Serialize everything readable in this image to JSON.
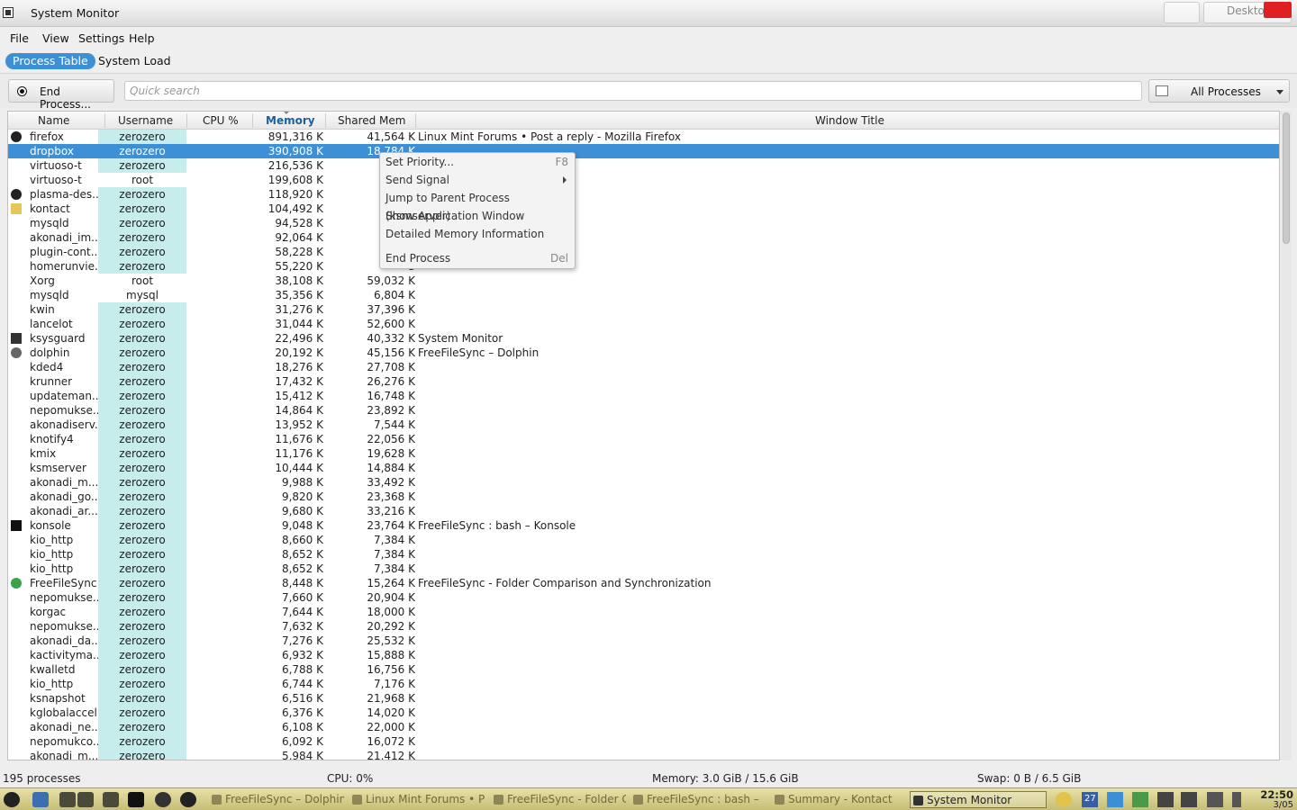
{
  "window": {
    "title": "System Monitor",
    "behind_title": "Desktop"
  },
  "menu": [
    "File",
    "View",
    "Settings",
    "Help"
  ],
  "tabs": [
    "Process Table",
    "System Load"
  ],
  "toolbar": {
    "end_process": "End Process...",
    "search_placeholder": "Quick search",
    "filter": "All Processes"
  },
  "columns": [
    "Name",
    "Username",
    "CPU %",
    "Memory",
    "Shared Mem",
    "Window Title"
  ],
  "rows": [
    {
      "icon": "firefox-icon",
      "name": "firefox",
      "user": "zerozero",
      "cpu": "",
      "mem": "891,316 K",
      "shared": "41,564 K",
      "title": "Linux Mint Forums • Post a reply - Mozilla Firefox"
    },
    {
      "icon": "",
      "name": "dropbox",
      "user": "zerozero",
      "cpu": "",
      "mem": "390,908 K",
      "shared": "18,784 K",
      "title": "",
      "selected": true
    },
    {
      "icon": "",
      "name": "virtuoso-t",
      "user": "zerozero",
      "cpu": "",
      "mem": "216,536 K",
      "shared": "1",
      "title": ""
    },
    {
      "icon": "",
      "name": "virtuoso-t",
      "user": "root",
      "cpu": "",
      "mem": "199,608 K",
      "shared": "1",
      "title": ""
    },
    {
      "icon": "plasma-icon",
      "name": "plasma-des...",
      "user": "zerozero",
      "cpu": "",
      "mem": "118,920 K",
      "shared": "6",
      "title": ""
    },
    {
      "icon": "kontact-icon",
      "name": "kontact",
      "user": "zerozero",
      "cpu": "",
      "mem": "104,492 K",
      "shared": "6",
      "title": ""
    },
    {
      "icon": "",
      "name": "mysqld",
      "user": "zerozero",
      "cpu": "",
      "mem": "94,528 K",
      "shared": "",
      "title": ""
    },
    {
      "icon": "",
      "name": "akonadi_im...",
      "user": "zerozero",
      "cpu": "",
      "mem": "92,064 K",
      "shared": "2",
      "title": ""
    },
    {
      "icon": "",
      "name": "plugin-cont...",
      "user": "zerozero",
      "cpu": "",
      "mem": "58,228 K",
      "shared": "2",
      "title": ""
    },
    {
      "icon": "",
      "name": "homerunvie...",
      "user": "zerozero",
      "cpu": "",
      "mem": "55,220 K",
      "shared": "3",
      "title": ""
    },
    {
      "icon": "",
      "name": "Xorg",
      "user": "root",
      "cpu": "",
      "mem": "38,108 K",
      "shared": "59,032 K",
      "title": ""
    },
    {
      "icon": "",
      "name": "mysqld",
      "user": "mysql",
      "cpu": "",
      "mem": "35,356 K",
      "shared": "6,804 K",
      "title": ""
    },
    {
      "icon": "",
      "name": "kwin",
      "user": "zerozero",
      "cpu": "",
      "mem": "31,276 K",
      "shared": "37,396 K",
      "title": ""
    },
    {
      "icon": "",
      "name": "lancelot",
      "user": "zerozero",
      "cpu": "",
      "mem": "31,044 K",
      "shared": "52,600 K",
      "title": ""
    },
    {
      "icon": "ksysguard-icon",
      "name": "ksysguard",
      "user": "zerozero",
      "cpu": "",
      "mem": "22,496 K",
      "shared": "40,332 K",
      "title": "System Monitor"
    },
    {
      "icon": "dolphin-icon",
      "name": "dolphin",
      "user": "zerozero",
      "cpu": "",
      "mem": "20,192 K",
      "shared": "45,156 K",
      "title": "FreeFileSync – Dolphin"
    },
    {
      "icon": "",
      "name": "kded4",
      "user": "zerozero",
      "cpu": "",
      "mem": "18,276 K",
      "shared": "27,708 K",
      "title": ""
    },
    {
      "icon": "",
      "name": "krunner",
      "user": "zerozero",
      "cpu": "",
      "mem": "17,432 K",
      "shared": "26,276 K",
      "title": ""
    },
    {
      "icon": "",
      "name": "updateman...",
      "user": "zerozero",
      "cpu": "",
      "mem": "15,412 K",
      "shared": "16,748 K",
      "title": ""
    },
    {
      "icon": "",
      "name": "nepomukse...",
      "user": "zerozero",
      "cpu": "",
      "mem": "14,864 K",
      "shared": "23,892 K",
      "title": ""
    },
    {
      "icon": "",
      "name": "akonadiserv...",
      "user": "zerozero",
      "cpu": "",
      "mem": "13,952 K",
      "shared": "7,544 K",
      "title": ""
    },
    {
      "icon": "",
      "name": "knotify4",
      "user": "zerozero",
      "cpu": "",
      "mem": "11,676 K",
      "shared": "22,056 K",
      "title": ""
    },
    {
      "icon": "",
      "name": "kmix",
      "user": "zerozero",
      "cpu": "",
      "mem": "11,176 K",
      "shared": "19,628 K",
      "title": ""
    },
    {
      "icon": "",
      "name": "ksmserver",
      "user": "zerozero",
      "cpu": "",
      "mem": "10,444 K",
      "shared": "14,884 K",
      "title": ""
    },
    {
      "icon": "",
      "name": "akonadi_m...",
      "user": "zerozero",
      "cpu": "",
      "mem": "9,988 K",
      "shared": "33,492 K",
      "title": ""
    },
    {
      "icon": "",
      "name": "akonadi_go...",
      "user": "zerozero",
      "cpu": "",
      "mem": "9,820 K",
      "shared": "23,368 K",
      "title": ""
    },
    {
      "icon": "",
      "name": "akonadi_ar...",
      "user": "zerozero",
      "cpu": "",
      "mem": "9,680 K",
      "shared": "33,216 K",
      "title": ""
    },
    {
      "icon": "konsole-icon",
      "name": "konsole",
      "user": "zerozero",
      "cpu": "",
      "mem": "9,048 K",
      "shared": "23,764 K",
      "title": "FreeFileSync : bash – Konsole"
    },
    {
      "icon": "",
      "name": "kio_http",
      "user": "zerozero",
      "cpu": "",
      "mem": "8,660 K",
      "shared": "7,384 K",
      "title": ""
    },
    {
      "icon": "",
      "name": "kio_http",
      "user": "zerozero",
      "cpu": "",
      "mem": "8,652 K",
      "shared": "7,384 K",
      "title": ""
    },
    {
      "icon": "",
      "name": "kio_http",
      "user": "zerozero",
      "cpu": "",
      "mem": "8,652 K",
      "shared": "7,384 K",
      "title": ""
    },
    {
      "icon": "freefilesync-icon",
      "name": "FreeFileSync",
      "user": "zerozero",
      "cpu": "",
      "mem": "8,448 K",
      "shared": "15,264 K",
      "title": "FreeFileSync - Folder Comparison and Synchronization"
    },
    {
      "icon": "",
      "name": "nepomukse...",
      "user": "zerozero",
      "cpu": "",
      "mem": "7,660 K",
      "shared": "20,904 K",
      "title": ""
    },
    {
      "icon": "",
      "name": "korgac",
      "user": "zerozero",
      "cpu": "",
      "mem": "7,644 K",
      "shared": "18,000 K",
      "title": ""
    },
    {
      "icon": "",
      "name": "nepomukse...",
      "user": "zerozero",
      "cpu": "",
      "mem": "7,632 K",
      "shared": "20,292 K",
      "title": ""
    },
    {
      "icon": "",
      "name": "akonadi_da...",
      "user": "zerozero",
      "cpu": "",
      "mem": "7,276 K",
      "shared": "25,532 K",
      "title": ""
    },
    {
      "icon": "",
      "name": "kactivityma...",
      "user": "zerozero",
      "cpu": "",
      "mem": "6,932 K",
      "shared": "15,888 K",
      "title": ""
    },
    {
      "icon": "",
      "name": "kwalletd",
      "user": "zerozero",
      "cpu": "",
      "mem": "6,788 K",
      "shared": "16,756 K",
      "title": ""
    },
    {
      "icon": "",
      "name": "kio_http",
      "user": "zerozero",
      "cpu": "",
      "mem": "6,744 K",
      "shared": "7,176 K",
      "title": ""
    },
    {
      "icon": "",
      "name": "ksnapshot",
      "user": "zerozero",
      "cpu": "",
      "mem": "6,516 K",
      "shared": "21,968 K",
      "title": ""
    },
    {
      "icon": "",
      "name": "kglobalaccel",
      "user": "zerozero",
      "cpu": "",
      "mem": "6,376 K",
      "shared": "14,020 K",
      "title": ""
    },
    {
      "icon": "",
      "name": "akonadi_ne...",
      "user": "zerozero",
      "cpu": "",
      "mem": "6,108 K",
      "shared": "22,000 K",
      "title": ""
    },
    {
      "icon": "",
      "name": "nepomukco...",
      "user": "zerozero",
      "cpu": "",
      "mem": "6,092 K",
      "shared": "16,072 K",
      "title": ""
    },
    {
      "icon": "",
      "name": "akonadi_m...",
      "user": "zerozero",
      "cpu": "",
      "mem": "5,984 K",
      "shared": "21,412 K",
      "title": ""
    }
  ],
  "context_menu": {
    "items": [
      {
        "label": "Set Priority...",
        "shortcut": "F8"
      },
      {
        "label": "Send Signal",
        "submenu": true
      },
      {
        "label": "Jump to Parent Process (ksmserver)"
      },
      {
        "label": "Show Application Window"
      },
      {
        "label": "Detailed Memory Information"
      },
      {
        "label": "End Process",
        "shortcut": "Del"
      }
    ]
  },
  "status": {
    "processes": "195 processes",
    "cpu": "CPU: 0%",
    "memory": "Memory: 3.0 GiB / 15.6 GiB",
    "swap": "Swap: 0 B / 6.5 GiB"
  },
  "taskbar": {
    "tasks": [
      "FreeFileSync – Dolphin",
      "Linux Mint Forums • Po",
      "FreeFileSync - Folder C",
      "FreeFileSync : bash –",
      "Summary - Kontact",
      "System Monitor"
    ],
    "active_task": 5,
    "calendar_day": "27",
    "clock_time": "22:50",
    "clock_date": "3/05"
  },
  "colors": {
    "accent": "#3d8fd6",
    "user_tint": "#c6ecec",
    "taskbar": "#d8d08e",
    "close": "#e02020"
  }
}
